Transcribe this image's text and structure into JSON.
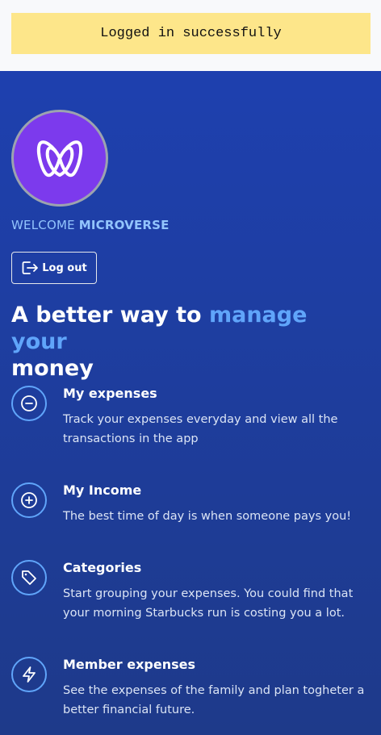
{
  "notice": {
    "text": "Logged in successfully"
  },
  "welcome": {
    "prefix": "WELCOME",
    "name": "MICROVERSE"
  },
  "logout": {
    "label": "Log out"
  },
  "headline": {
    "part1": "A better way to ",
    "accent": "manage your",
    "part2": "money"
  },
  "features": [
    {
      "icon": "minus-circle-icon",
      "title": "My expenses",
      "description": "Track your expenses everyday and view all the transactions in the app"
    },
    {
      "icon": "plus-circle-icon",
      "title": "My Income",
      "description": "The best time of day is when someone pays you!"
    },
    {
      "icon": "tag-icon",
      "title": "Categories",
      "description": "Start grouping your expenses. You could find that your morning Starbucks run is costing you a lot."
    },
    {
      "icon": "lightning-icon",
      "title": "Member expenses",
      "description": "See the expenses of the family and plan togheter a better financial future."
    }
  ],
  "colors": {
    "accent": "#60a5fa",
    "notice_bg": "#fde68a",
    "hero_bg": "#1e40af",
    "avatar_bg": "#7c3aed"
  }
}
